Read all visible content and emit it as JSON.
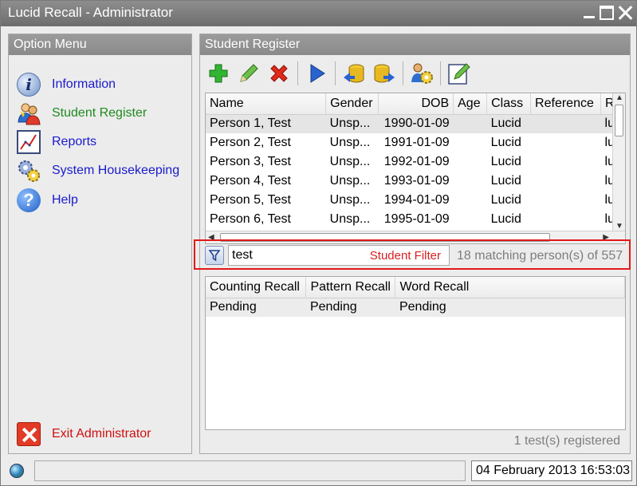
{
  "window": {
    "title": "Lucid Recall - Administrator"
  },
  "option_menu": {
    "header": "Option Menu",
    "items": [
      {
        "label": "Information",
        "icon": "info-icon"
      },
      {
        "label": "Student Register",
        "icon": "students-icon",
        "active": true
      },
      {
        "label": "Reports",
        "icon": "chart-icon"
      },
      {
        "label": "System Housekeeping",
        "icon": "gears-icon"
      },
      {
        "label": "Help",
        "icon": "help-icon"
      }
    ],
    "exit_label": "Exit Administrator"
  },
  "student_register": {
    "header": "Student Register",
    "toolbar": [
      "add-icon",
      "edit-icon",
      "delete-icon",
      "play-icon",
      "import-icon",
      "export-icon",
      "user-settings-icon",
      "notes-icon"
    ],
    "columns": [
      "Name",
      "Gender",
      "DOB",
      "Age",
      "Class",
      "Reference",
      "R"
    ],
    "rows": [
      {
        "name": "Person 1, Test",
        "gender": "Unsp...",
        "dob": "1990-01-09",
        "age": "",
        "class": "Lucid",
        "reference": "",
        "r": "lu"
      },
      {
        "name": "Person 2, Test",
        "gender": "Unsp...",
        "dob": "1991-01-09",
        "age": "",
        "class": "Lucid",
        "reference": "",
        "r": "lu"
      },
      {
        "name": "Person 3, Test",
        "gender": "Unsp...",
        "dob": "1992-01-09",
        "age": "",
        "class": "Lucid",
        "reference": "",
        "r": "lu"
      },
      {
        "name": "Person 4, Test",
        "gender": "Unsp...",
        "dob": "1993-01-09",
        "age": "",
        "class": "Lucid",
        "reference": "",
        "r": "lu"
      },
      {
        "name": "Person 5, Test",
        "gender": "Unsp...",
        "dob": "1994-01-09",
        "age": "",
        "class": "Lucid",
        "reference": "",
        "r": "lu"
      },
      {
        "name": "Person 6, Test",
        "gender": "Unsp...",
        "dob": "1995-01-09",
        "age": "",
        "class": "Lucid",
        "reference": "",
        "r": "lu"
      }
    ],
    "filter": {
      "value": "test",
      "hint": "Student Filter",
      "match_text": "18 matching person(s) of 557"
    },
    "tests": {
      "columns": [
        "Counting Recall",
        "Pattern Recall",
        "Word Recall"
      ],
      "rows": [
        [
          "Pending",
          "Pending",
          "Pending"
        ]
      ],
      "count_text": "1 test(s) registered"
    }
  },
  "statusbar": {
    "datetime": "04 February 2013 16:53:03"
  }
}
